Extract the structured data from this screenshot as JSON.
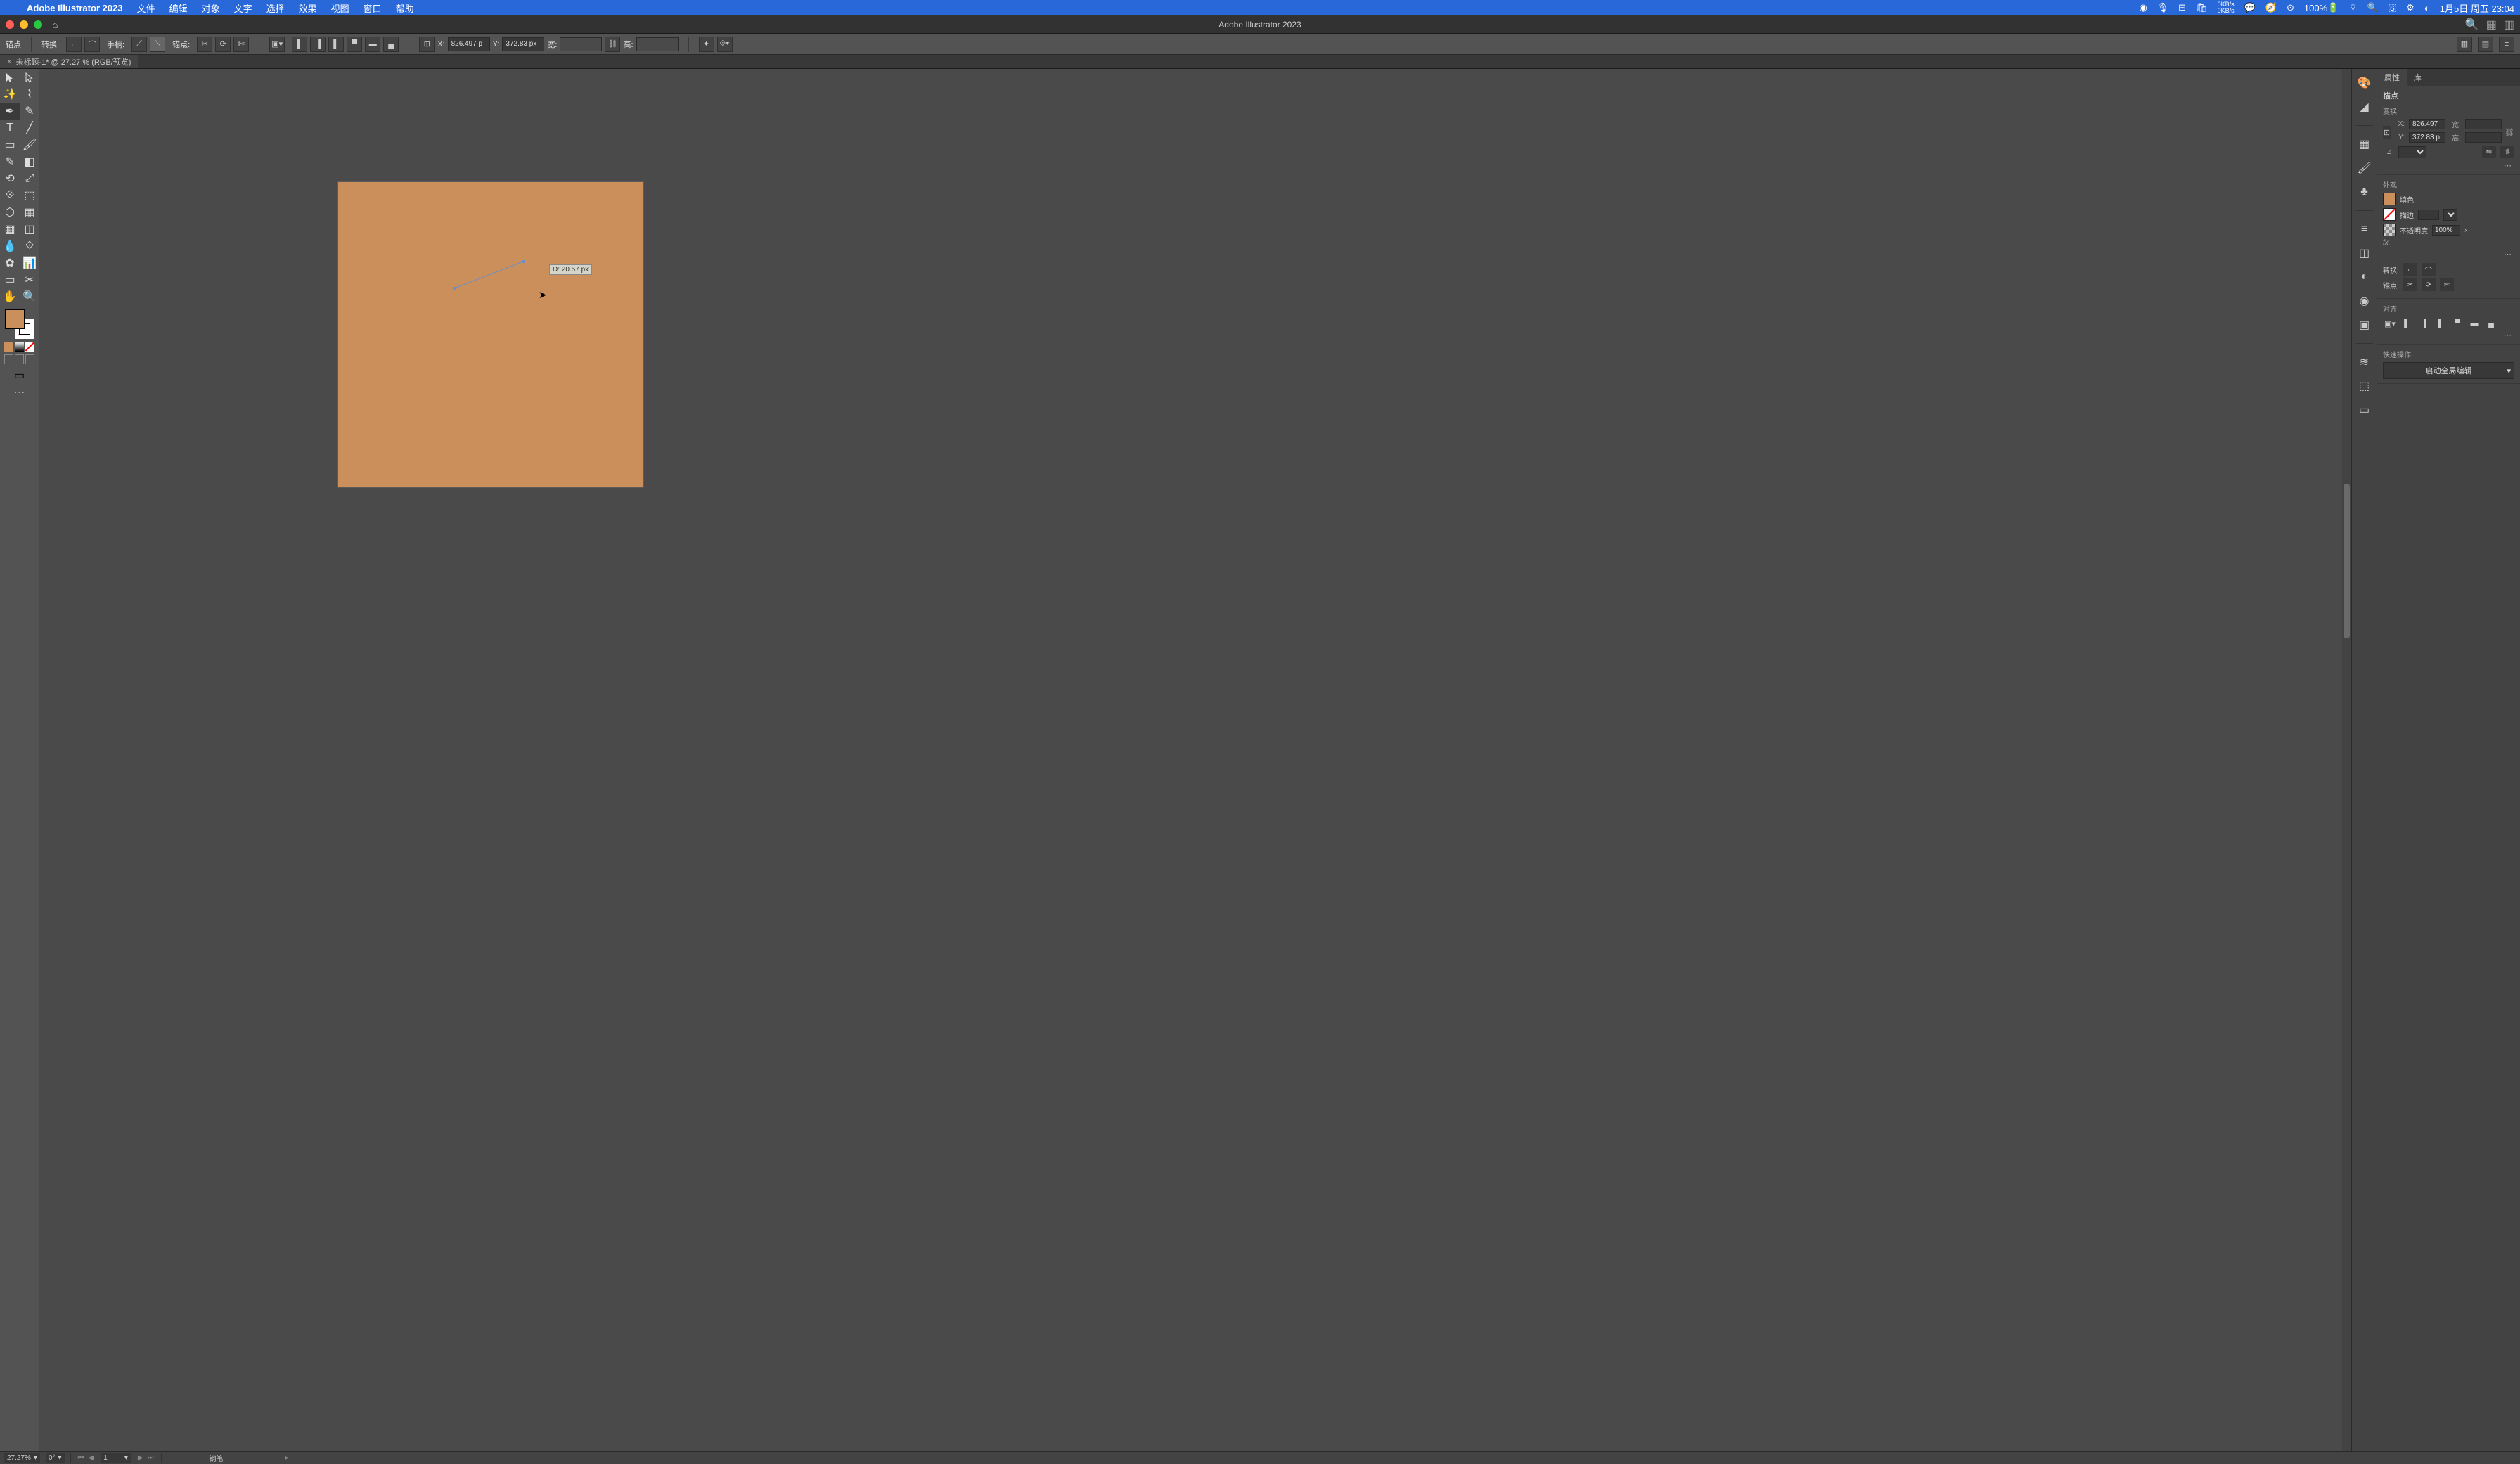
{
  "menubar": {
    "app_name": "Adobe Illustrator 2023",
    "items": [
      "文件",
      "编辑",
      "对象",
      "文字",
      "选择",
      "效果",
      "视图",
      "窗口",
      "帮助"
    ],
    "battery": "100%",
    "net_stats_up": "0KB/s",
    "net_stats_down": "0KB/s",
    "datetime": "1月5日 周五 23:04"
  },
  "window": {
    "title": "Adobe Illustrator 2023"
  },
  "controlbar": {
    "label_anchor": "锚点",
    "label_convert": "转换:",
    "label_handle": "手柄:",
    "label_anchor2": "锚点:",
    "x_label": "X:",
    "x_val": "826.497 p",
    "y_label": "Y:",
    "y_val": "372.83 px",
    "w_label": "宽:",
    "h_label": "高:"
  },
  "tab": {
    "name": "未标题-1* @ 27.27 % (RGB/预览)"
  },
  "canvas": {
    "tooltip": "D: 20.57 px"
  },
  "props": {
    "tab_properties": "属性",
    "tab_library": "库",
    "section_anchor": "锚点",
    "section_transform": "变换",
    "x_label": "X:",
    "x_val": "826.497",
    "y_label": "Y:",
    "y_val": "372.83 p",
    "w_label": "宽:",
    "h_label": "高:",
    "angle_label": "⊿:",
    "section_appearance": "外观",
    "fill_label": "填色",
    "stroke_label": "描边",
    "opacity_label": "不透明度",
    "opacity_val": "100%",
    "fx_label": "fx.",
    "convert_label": "转换:",
    "anchors_label": "锚点:",
    "section_align": "对齐",
    "section_quickactions": "快速操作",
    "action_global_edit": "启动全局编辑"
  },
  "statusbar": {
    "zoom": "27.27%",
    "rotation": "0°",
    "artboard": "1",
    "tool": "钢笔"
  },
  "colors": {
    "fill": "#cb8f5b"
  }
}
